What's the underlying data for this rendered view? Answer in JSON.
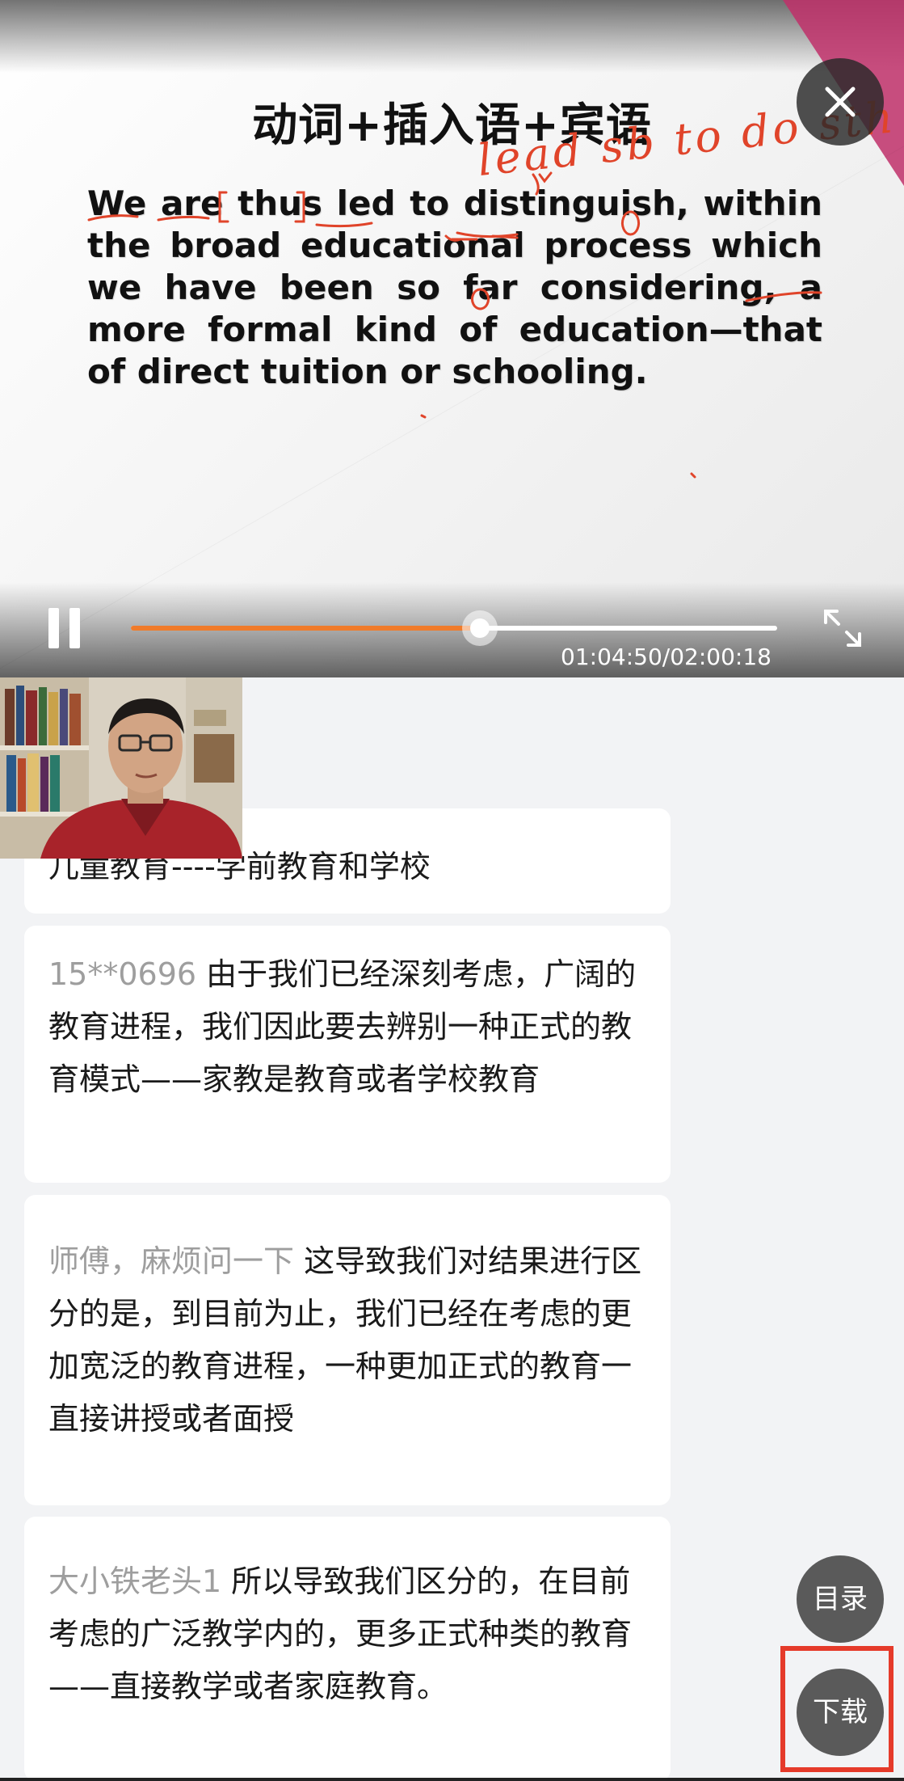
{
  "slide": {
    "title": "动词+插入语+宾语",
    "body": "We are thus led to distinguish, within the broad educational process which we have been so far considering, a more formal kind of education—that of direct tuition or schooling.",
    "handwriting": "lead sb to do sth"
  },
  "player": {
    "state": "playing",
    "progress": 0.54,
    "time_display": "01:04:50/02:00:18",
    "colors": {
      "progress": "#f07b2a",
      "track": "#ffffff"
    }
  },
  "comments": {
    "partial_text": "儿童教育----学前教育和学校",
    "items": [
      {
        "user": "15**0696",
        "text": "由于我们已经深刻考虑，广阔的教育进程，我们因此要去辨别一种正式的教育模式——家教是教育或者学校教育"
      },
      {
        "user": "师傅，麻烦问一下",
        "text": "这导致我们对结果进行区分的是，到目前为止，我们已经在考虑的更加宽泛的教育进程，一种更加正式的教育一直接讲授或者面授"
      },
      {
        "user": "大小铁老头1",
        "text": "所以导致我们区分的，在目前考虑的广泛教学内的，更多正式种类的教育——直接教学或者家庭教育。"
      }
    ]
  },
  "buttons": {
    "catalog": "目录",
    "download": "下载"
  },
  "icons": {
    "close": "close-icon",
    "pause": "pause-icon",
    "fullscreen": "fullscreen-icon"
  },
  "highlight_color": "#e53a2a"
}
